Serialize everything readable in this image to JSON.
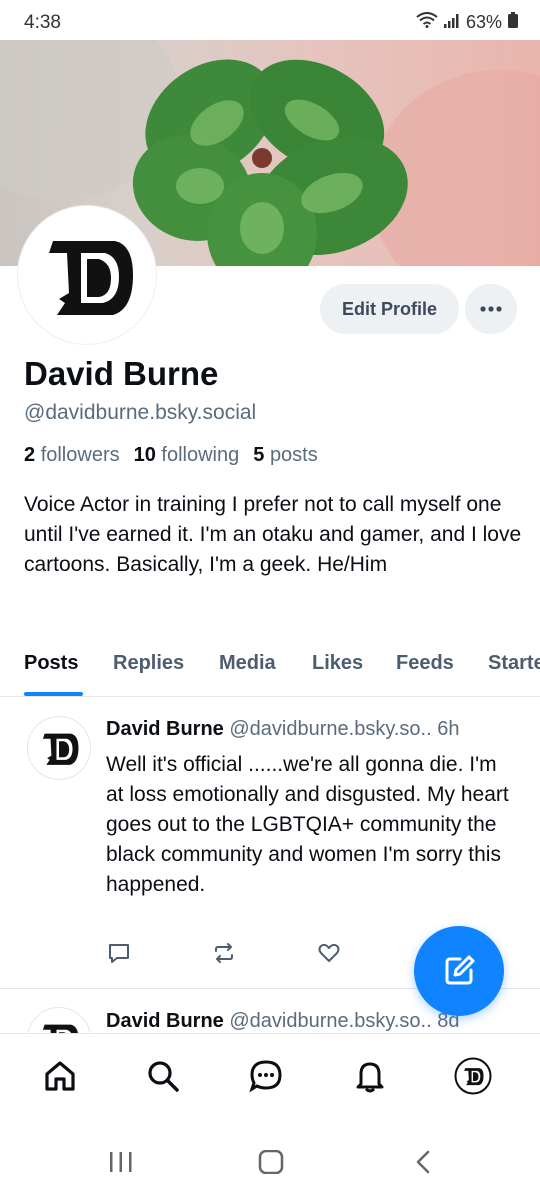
{
  "status_bar": {
    "time": "4:38",
    "battery": "63%"
  },
  "profile": {
    "display_name": "David Burne",
    "handle": "@davidburne.bsky.social",
    "followers_count": "2",
    "followers_label": "followers",
    "following_count": "10",
    "following_label": "following",
    "posts_count": "5",
    "posts_label": "posts",
    "bio": "Voice Actor in training I prefer not to call myself one until I've earned it. I'm an otaku and gamer, and I love cartoons. Basically, I'm a geek. He/Him",
    "edit_label": "Edit Profile",
    "avatar_letter": "D"
  },
  "tabs": [
    "Posts",
    "Replies",
    "Media",
    "Likes",
    "Feeds",
    "Starter"
  ],
  "active_tab": "Posts",
  "posts": [
    {
      "author": "David Burne",
      "handle": "@davidburne.bsky.so..",
      "time": "6h",
      "text": "Well it's official ......we're all gonna die. I'm at loss emotionally and disgusted. My heart goes out to the LGBTQIA+ community the black community and women I'm sorry this happened."
    },
    {
      "author": "David Burne",
      "handle": "@davidburne.bsky.so..",
      "time": "8d"
    }
  ],
  "icons": {
    "reply": "comment-icon",
    "repost": "repost-icon",
    "like": "heart-icon",
    "compose": "compose-icon",
    "nav": [
      "home-icon",
      "search-icon",
      "chat-icon",
      "bell-icon",
      "profile-avatar-icon"
    ]
  },
  "colors": {
    "accent": "#1083fe",
    "muted": "#5b6b7e"
  }
}
